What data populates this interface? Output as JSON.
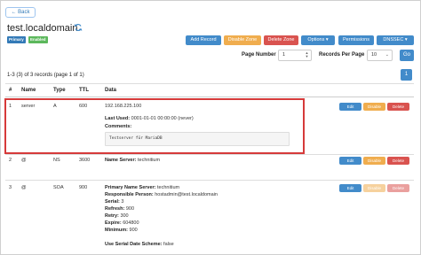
{
  "nav": {
    "back_label": "← Back"
  },
  "zone": {
    "name": "test.localdomain",
    "badges": {
      "primary": "Primary",
      "enabled": "Enabled"
    }
  },
  "toolbar": {
    "add_record": "Add Record",
    "disable_zone": "Disable Zone",
    "delete_zone": "Delete Zone",
    "options": "Options ▾",
    "permissions": "Permissions",
    "dnssec": "DNSSEC ▾"
  },
  "pagination": {
    "page_number_label": "Page Number",
    "page_number_value": "1",
    "records_per_page_label": "Records Per Page",
    "records_per_page_value": "10",
    "go_label": "Go",
    "summary": "1-3 (3) of 3 records (page 1 of 1)",
    "current_page": "1"
  },
  "table": {
    "headers": {
      "num": "#",
      "name": "Name",
      "type": "Type",
      "ttl": "TTL",
      "data": "Data"
    },
    "rows": [
      {
        "num": "1",
        "name": "server",
        "type": "A",
        "ttl": "600",
        "value": "192.168.225.100",
        "last_used_label": "Last Used:",
        "last_used": "0001-01-01 00:00:00 (never)",
        "comments_label": "Comments:",
        "comment": "Testserver für MariaDB",
        "actions": {
          "edit": "Edit",
          "disable": "Disable",
          "delete": "Delete"
        }
      },
      {
        "num": "2",
        "name": "@",
        "type": "NS",
        "ttl": "3600",
        "name_server_label": "Name Server:",
        "name_server": "technitium",
        "actions": {
          "edit": "Edit",
          "disable": "Disable",
          "delete": "Delete"
        }
      },
      {
        "num": "3",
        "name": "@",
        "type": "SOA",
        "ttl": "900",
        "primary_ns_label": "Primary Name Server:",
        "primary_ns": "technitium",
        "responsible_label": "Responsible Person:",
        "responsible": "hostadmin@test.localdomain",
        "serial_label": "Serial:",
        "serial": "3",
        "refresh_label": "Refresh:",
        "refresh": "900",
        "retry_label": "Retry:",
        "retry": "300",
        "expire_label": "Expire:",
        "expire": "604800",
        "minimum_label": "Minimum:",
        "minimum": "900",
        "serial_scheme_label": "Use Serial Date Scheme:",
        "serial_scheme": "false",
        "actions": {
          "edit": "Edit",
          "disable": "Disable",
          "delete": "Delete"
        }
      }
    ]
  },
  "colors": {
    "primary": "#428bca",
    "warning": "#f0ad4e",
    "danger": "#d9534f",
    "success": "#5cb85c",
    "highlight": "#d63a3a"
  }
}
